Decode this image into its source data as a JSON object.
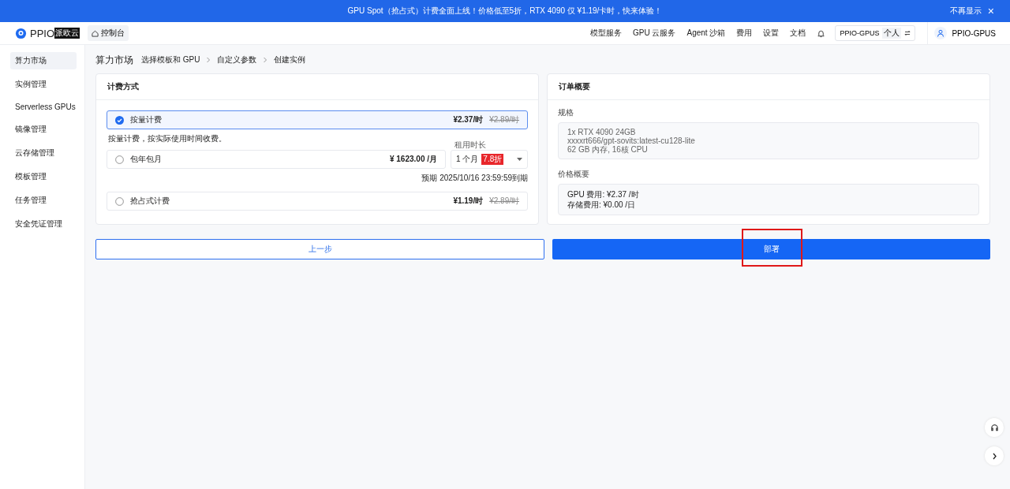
{
  "banner": {
    "text": "GPU Spot（抢占式）计费全面上线！价格低至5折，RTX 4090 仅 ¥1.19/卡时，快来体验！",
    "dismiss": "不再显示",
    "close": "×"
  },
  "header": {
    "logo": "PPIO",
    "logo_badge": "派欧云",
    "console": "控制台",
    "nav": [
      "模型服务",
      "GPU 云服务",
      "Agent 沙箱",
      "费用",
      "设置",
      "文档"
    ],
    "account": {
      "name": "PPIO-GPUS",
      "type": "个人"
    },
    "user": "PPIO-GPUS"
  },
  "sidebar": {
    "items": [
      {
        "label": "算力市场",
        "selected": true
      },
      {
        "label": "实例管理",
        "selected": false
      },
      {
        "label": "Serverless GPUs",
        "selected": false
      },
      {
        "label": "镜像管理",
        "selected": false
      },
      {
        "label": "云存储管理",
        "selected": false
      },
      {
        "label": "模板管理",
        "selected": false
      },
      {
        "label": "任务管理",
        "selected": false
      },
      {
        "label": "安全凭证管理",
        "selected": false
      }
    ]
  },
  "breadcrumb": {
    "title": "算力市场",
    "steps": [
      "选择模板和 GPU",
      "自定义参数",
      "创建实例"
    ]
  },
  "billing": {
    "title": "计费方式",
    "options": [
      {
        "label": "按量计费",
        "selected": true,
        "price": "¥2.37/时",
        "old_price": "¥2.89/时",
        "note": "按量计费，按实际使用时间收费。"
      },
      {
        "label": "包年包月",
        "selected": false,
        "price": "¥ 1623.00 /月",
        "duration_label": "租用时长",
        "duration": "1 个月",
        "discount": "7.8折",
        "expiry": "预期  2025/10/16 23:59:59到期"
      },
      {
        "label": "抢占式计费",
        "selected": false,
        "price": "¥1.19/时",
        "old_price": "¥2.89/时"
      }
    ]
  },
  "summary": {
    "title": "订单概要",
    "spec_label": "规格",
    "spec": [
      "1x RTX 4090 24GB",
      "xxxxrt666/gpt-sovits:latest-cu128-lite",
      "62 GB 内存, 16核 CPU"
    ],
    "price_label": "价格概要",
    "prices": [
      "GPU 费用:  ¥2.37 /时",
      "存储费用:  ¥0.00 /日"
    ]
  },
  "actions": {
    "back": "上一步",
    "deploy": "部署",
    "deploy_highlighted": true
  }
}
